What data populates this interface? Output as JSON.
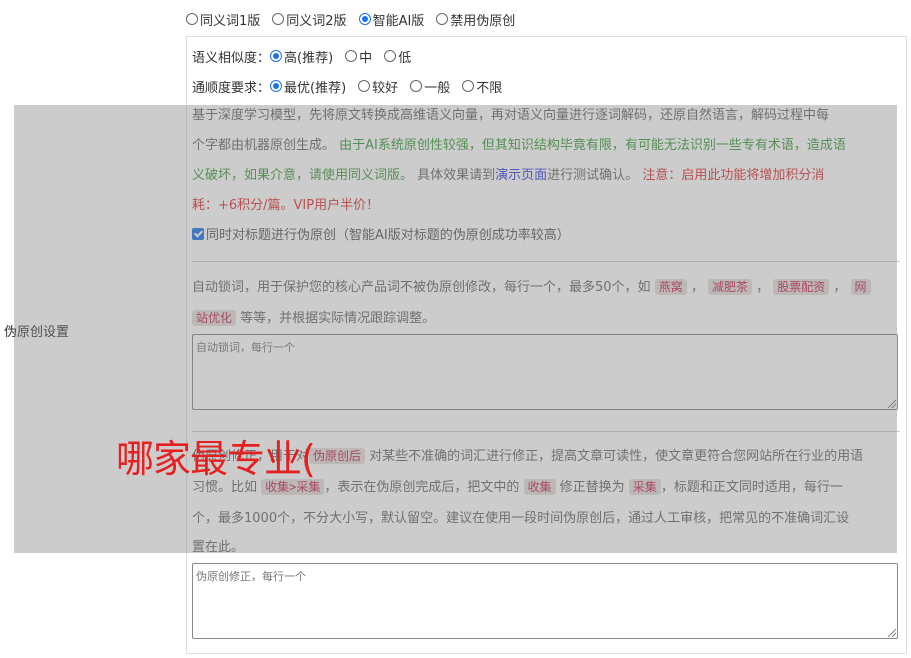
{
  "mode_options": [
    {
      "label": "同义词1版",
      "checked": false
    },
    {
      "label": "同义词2版",
      "checked": false
    },
    {
      "label": "智能AI版",
      "checked": true
    },
    {
      "label": "禁用伪原创",
      "checked": false
    }
  ],
  "similarity": {
    "label": "语义相似度：",
    "options": [
      {
        "label": "高(推荐)",
        "checked": true
      },
      {
        "label": "中",
        "checked": false
      },
      {
        "label": "低",
        "checked": false
      }
    ]
  },
  "fluency": {
    "label": "通顺度要求：",
    "options": [
      {
        "label": "最优(推荐)",
        "checked": true
      },
      {
        "label": "较好",
        "checked": false
      },
      {
        "label": "一般",
        "checked": false
      },
      {
        "label": "不限",
        "checked": false
      }
    ]
  },
  "section_label": "伪原创设置",
  "ai_desc": {
    "line1": "基于深度学习模型，先将原文转换成高维语义向量，再对语义向量进行逐词解码，还原自然语言，解码过程中每",
    "line2_plain": "个字都由机器原创生成。 ",
    "line2_green": "由于AI系统原创性较强，但其知识结构毕竟有限，有可能无法识别一些专有术语，造成语",
    "line3_green": "义破坏，如果介意，请使用同义词版。",
    "line3_plain1": " 具体效果请到",
    "line3_link": "演示页面",
    "line3_plain2": "进行测试确认。 ",
    "line3_red": "注意：启用此功能将增加积分消",
    "line4_red": "耗：+6积分/篇。VIP用户半价！"
  },
  "title_checkbox": {
    "label": "同时对标题进行伪原创（智能AI版对标题的伪原创成功率较高）",
    "checked": true
  },
  "lock_desc": {
    "text1": "自动锁词，用于保护您的核心产品词不被伪原创修改，每行一个，最多50个，如 ",
    "tags": [
      "燕窝",
      "减肥茶",
      "股票配资"
    ],
    "tag_last_a": "网",
    "tag_last_b": "站优化",
    "text2": " 等等，并根据实际情况跟踪调整。"
  },
  "lock_textarea": {
    "placeholder": "自动锁词，每行一个"
  },
  "fix_desc": {
    "line1_a": "伪原创修正，用于对",
    "line1_code": "伪原创后",
    "line1_b": " 对某些不准确的词汇进行修正，提高文章可读性，使文章更符合您网站所在行业的用语",
    "line2_a": "习惯。比如 ",
    "line2_code1": "收集>采集",
    "line2_b": "，表示在伪原创完成后，把文中的 ",
    "line2_code2": "收集",
    "line2_c": " 修正替换为 ",
    "line2_code3": "采集",
    "line2_d": "，标题和正文同时适用，每行一",
    "line3": "个，最多1000个，不分大小写，默认留空。建议在使用一段时间伪原创后，通过人工审核，把常见的不准确词汇设",
    "line4": "置在此。"
  },
  "fix_textarea": {
    "placeholder": "伪原创修正，每行一个"
  },
  "watermark": "哪家最专业("
}
